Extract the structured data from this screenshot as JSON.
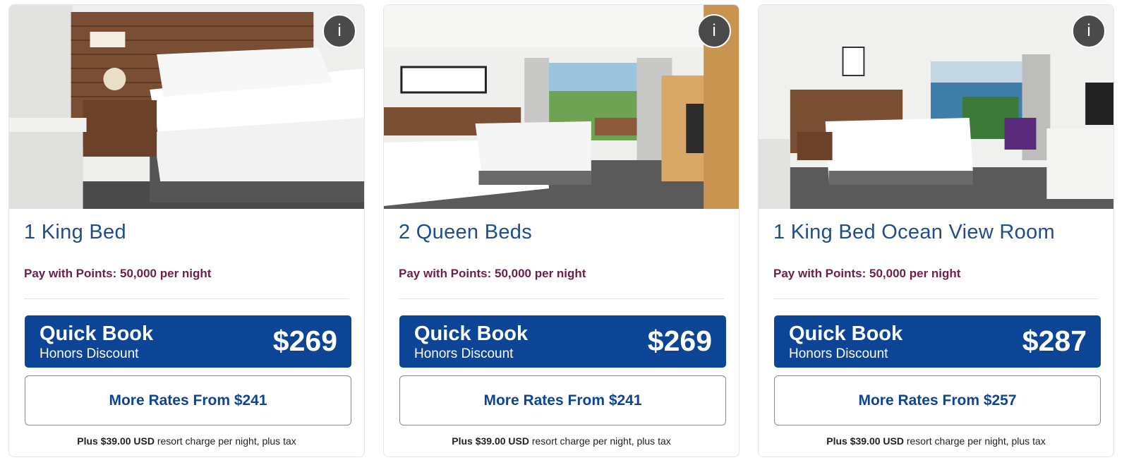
{
  "rooms": [
    {
      "title": "1 King Bed",
      "points": "Pay with Points: 50,000 per night",
      "quick_book_label": "Quick Book",
      "quick_book_subtitle": "Honors Discount",
      "price": "$269",
      "more_rates": "More Rates From $241",
      "resort_charge_amount": "Plus $39.00 USD",
      "resort_charge_text": "resort charge per night, plus tax",
      "info_label": "i"
    },
    {
      "title": "2 Queen Beds",
      "points": "Pay with Points: 50,000 per night",
      "quick_book_label": "Quick Book",
      "quick_book_subtitle": "Honors Discount",
      "price": "$269",
      "more_rates": "More Rates From $241",
      "resort_charge_amount": "Plus $39.00 USD",
      "resort_charge_text": "resort charge per night, plus tax",
      "info_label": "i"
    },
    {
      "title": "1 King Bed Ocean View Room",
      "points": "Pay with Points: 50,000 per night",
      "quick_book_label": "Quick Book",
      "quick_book_subtitle": "Honors Discount",
      "price": "$287",
      "more_rates": "More Rates From $257",
      "resort_charge_amount": "Plus $39.00 USD",
      "resort_charge_text": "resort charge per night, plus tax",
      "info_label": "i"
    }
  ],
  "colors": {
    "brand_blue": "#0d4596",
    "title_blue": "#1f4e8c",
    "points_plum": "#6b1f4a"
  }
}
